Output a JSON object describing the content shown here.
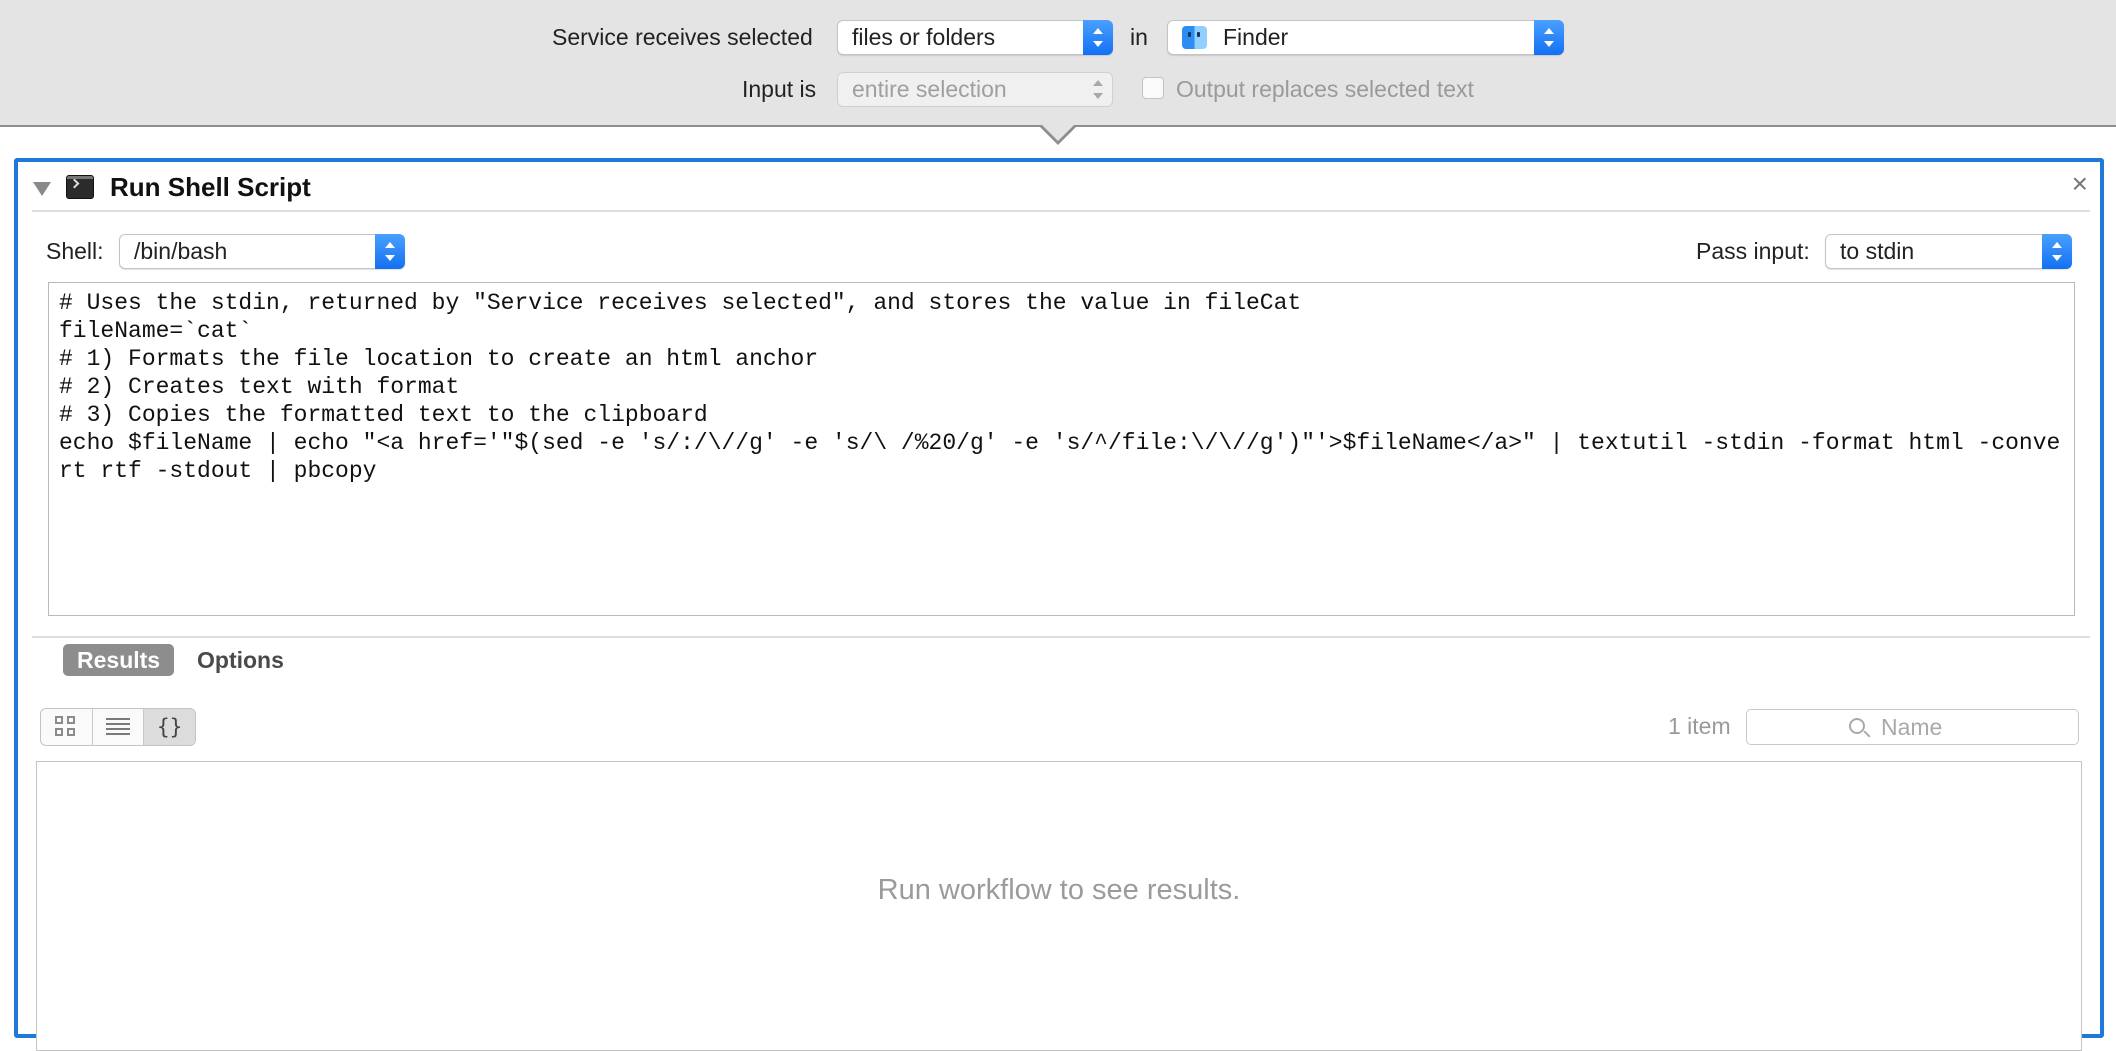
{
  "service": {
    "receives_label": "Service receives selected",
    "receives_value": "files or folders",
    "in_label": "in",
    "app_value": "Finder",
    "input_label": "Input is",
    "input_value": "entire selection",
    "output_replaces_label": "Output replaces selected text",
    "output_replaces_checked": false
  },
  "action": {
    "title": "Run Shell Script",
    "close_glyph": "×",
    "shell_label": "Shell:",
    "shell_value": "/bin/bash",
    "pass_input_label": "Pass input:",
    "pass_input_value": "to stdin",
    "script": "# Uses the stdin, returned by \"Service receives selected\", and stores the value in fileCat\nfileName=`cat`\n# 1) Formats the file location to create an html anchor\n# 2) Creates text with format\n# 3) Copies the formatted text to the clipboard\necho $fileName | echo \"<a href='\"$(sed -e 's/:/\\//g' -e 's/\\ /%20/g' -e 's/^/file:\\/\\//g')\"'>$fileName</a>\" | textutil -stdin -format html -convert rtf -stdout | pbcopy",
    "tabs": [
      {
        "label": "Results",
        "active": true
      },
      {
        "label": "Options",
        "active": false
      }
    ],
    "view_modes": [
      "icon-view",
      "list-view",
      "code-view"
    ],
    "code_view_glyph": "{}",
    "item_count": "1 item",
    "search_placeholder": "Name",
    "empty_message": "Run workflow to see results."
  },
  "colors": {
    "accent": "#1f79d9",
    "popup_stepper": "#1470f2",
    "topbar_bg": "#e4e4e4"
  }
}
